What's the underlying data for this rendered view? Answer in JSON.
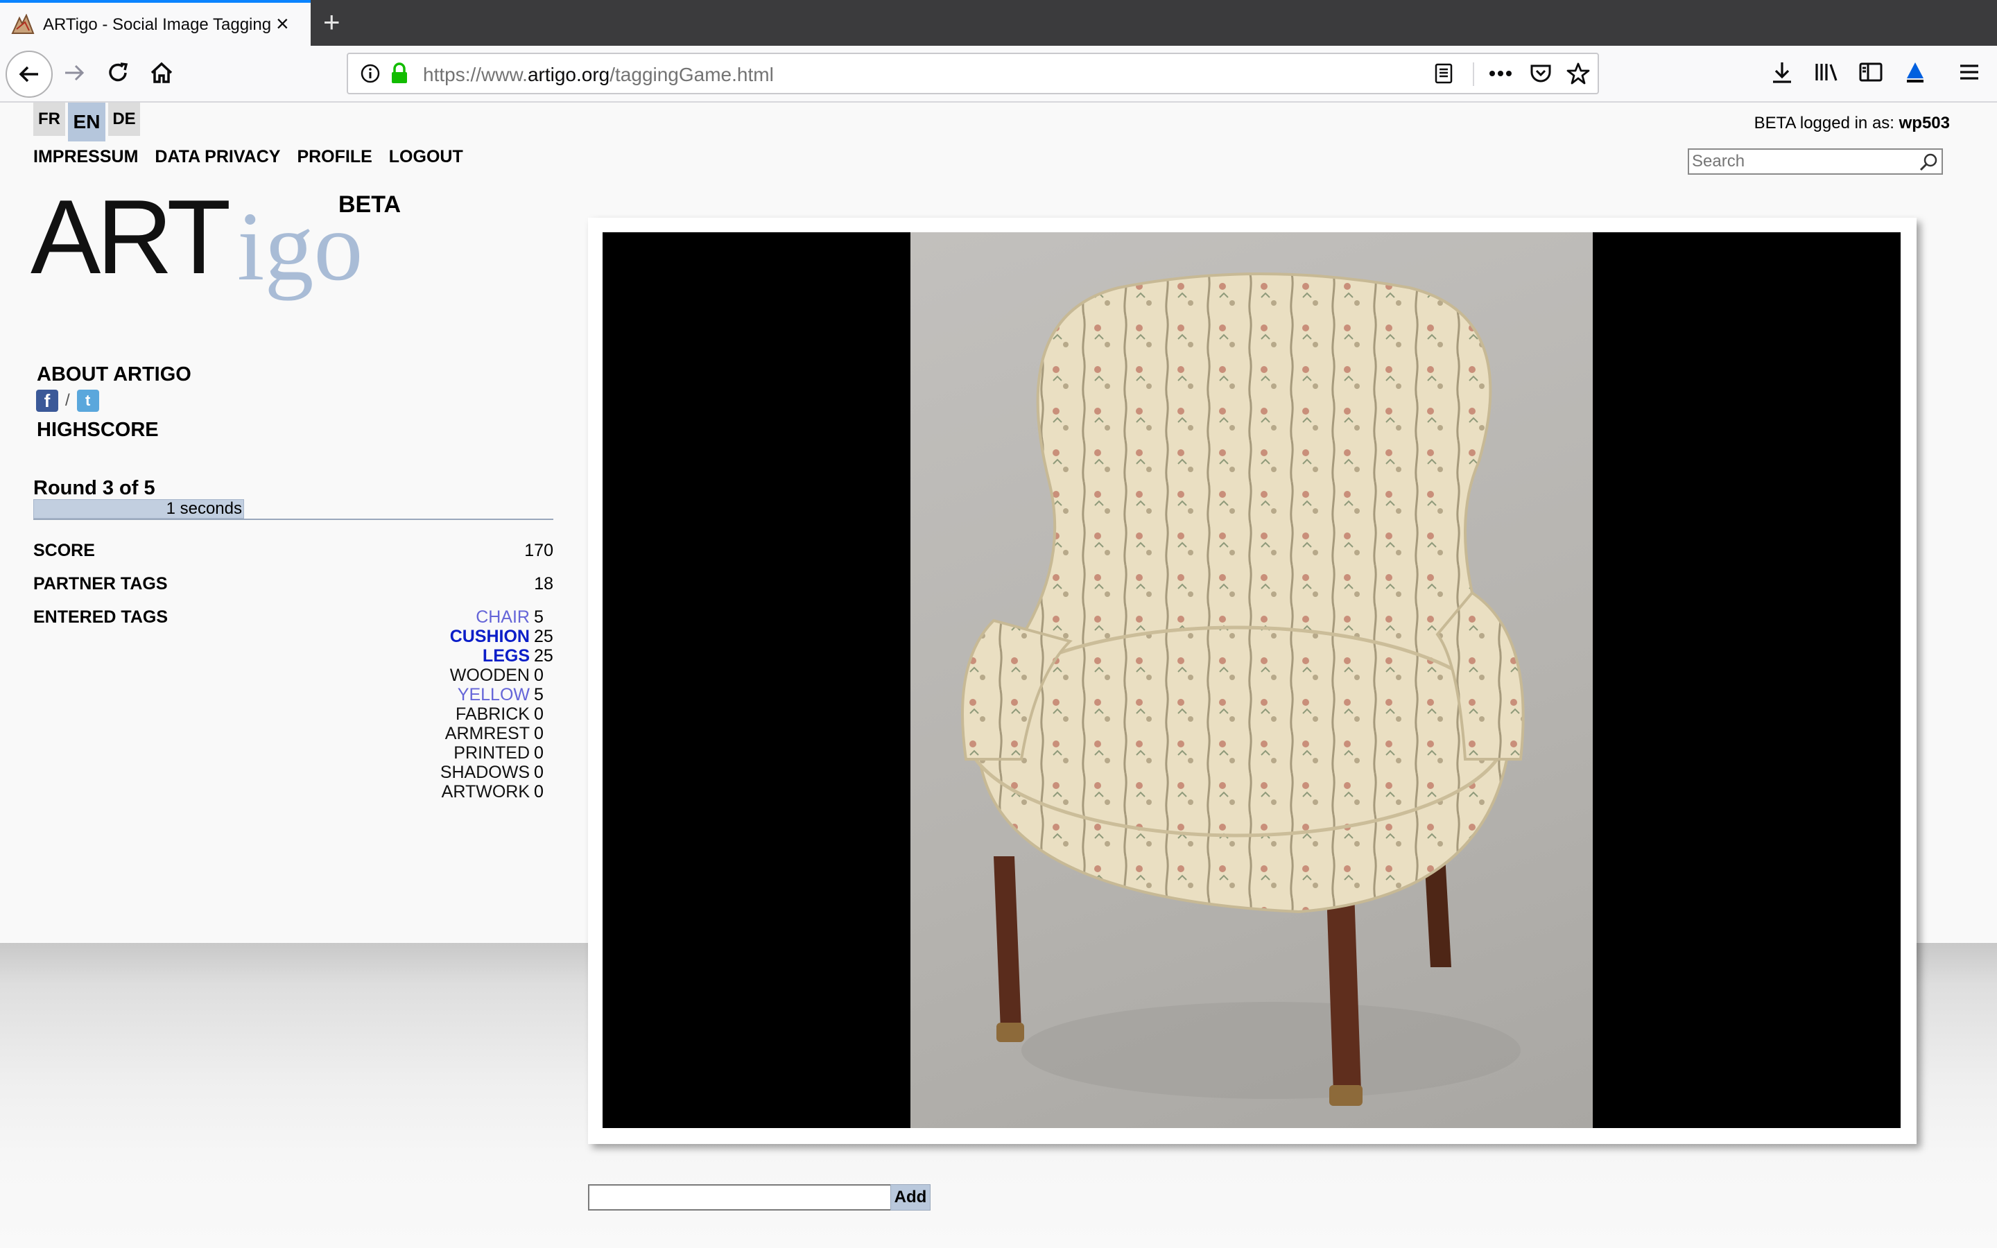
{
  "browser": {
    "tab_title": "ARTigo - Social Image Tagging",
    "tab_close": "×",
    "new_tab": "+",
    "url_prefix": "https://www.",
    "url_domain": "artigo.org",
    "url_path": "/taggingGame.html"
  },
  "languages": [
    {
      "code": "FR",
      "active": false
    },
    {
      "code": "EN",
      "active": true
    },
    {
      "code": "DE",
      "active": false
    }
  ],
  "nav": {
    "impressum": "IMPRESSUM",
    "privacy": "DATA PRIVACY",
    "profile": "PROFILE",
    "logout": "LOGOUT"
  },
  "login": {
    "prefix": "BETA logged in as: ",
    "user": "wp503"
  },
  "search": {
    "placeholder": "Search"
  },
  "logo": {
    "art": "ART",
    "igo": "igo",
    "beta": "BETA"
  },
  "sidebar": {
    "about": "ABOUT ARTIGO",
    "social_sep": "/",
    "highscore": "HIGHSCORE"
  },
  "game": {
    "round": "Round 3 of 5",
    "timer": "1 seconds",
    "score_label": "SCORE",
    "score": "170",
    "partner_label": "PARTNER TAGS",
    "partner": "18",
    "entered_label": "ENTERED TAGS",
    "tags": [
      {
        "name": "CHAIR",
        "score": "5",
        "style": "light"
      },
      {
        "name": "CUSHION",
        "score": "25",
        "style": "strong"
      },
      {
        "name": "LEGS",
        "score": "25",
        "style": "strong"
      },
      {
        "name": "WOODEN",
        "score": "0",
        "style": "plain"
      },
      {
        "name": "YELLOW",
        "score": "5",
        "style": "light"
      },
      {
        "name": "FABRICK",
        "score": "0",
        "style": "plain"
      },
      {
        "name": "ARMREST",
        "score": "0",
        "style": "plain"
      },
      {
        "name": "PRINTED",
        "score": "0",
        "style": "plain"
      },
      {
        "name": "SHADOWS",
        "score": "0",
        "style": "plain"
      },
      {
        "name": "ARTWORK",
        "score": "0",
        "style": "plain"
      }
    ]
  },
  "input": {
    "value": "",
    "add_label": "Add"
  },
  "colors": {
    "tag_light": "#6565d8",
    "tag_strong": "#0c1ec8",
    "accent_blue": "#b5c6dc",
    "timer_bar": "#c2cfe0"
  },
  "icons": {
    "back": "back-arrow-icon",
    "forward": "forward-arrow-icon",
    "reload": "reload-icon",
    "home": "home-icon",
    "info": "info-icon",
    "lock": "lock-icon",
    "reader": "reader-view-icon",
    "more": "more-icon",
    "pocket": "pocket-icon",
    "bookmark": "star-icon",
    "download": "download-icon",
    "library": "library-icon",
    "sidebar": "sidebar-icon",
    "ext": "extension-icon",
    "menu": "hamburger-icon"
  }
}
